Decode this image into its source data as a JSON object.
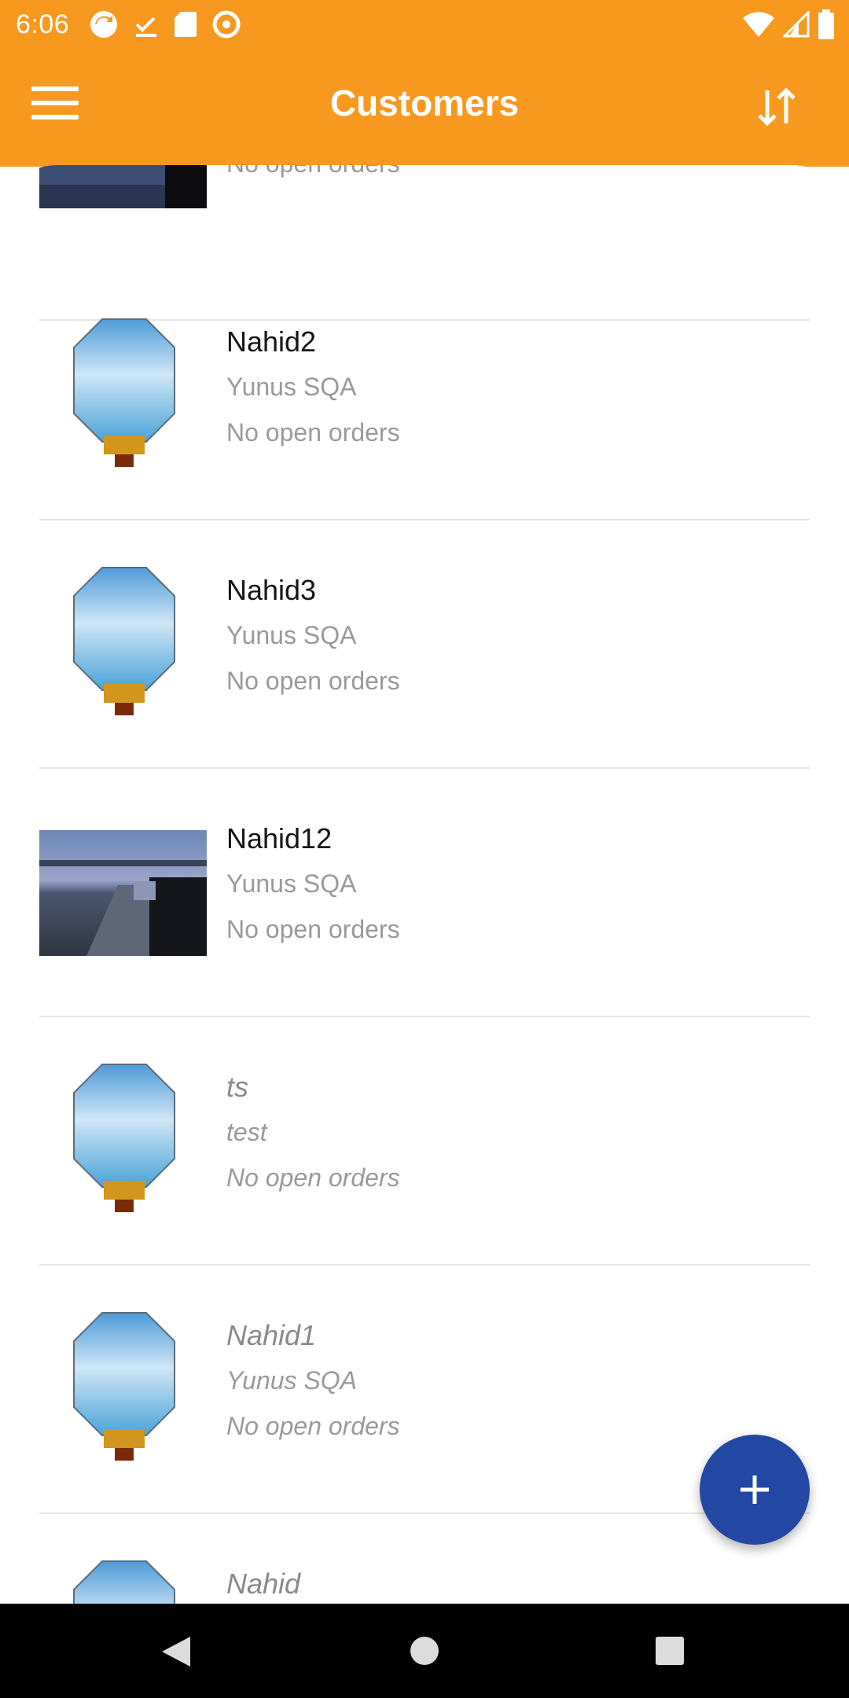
{
  "status_bar": {
    "time": "6:06"
  },
  "app_bar": {
    "title": "Customers"
  },
  "customers": [
    {
      "name": "",
      "company": "",
      "orders": "No open orders"
    },
    {
      "name": "Nahid2",
      "company": "Yunus SQA",
      "orders": "No open orders"
    },
    {
      "name": "Nahid3",
      "company": "Yunus SQA",
      "orders": "No open orders"
    },
    {
      "name": "Nahid12",
      "company": "Yunus SQA",
      "orders": "No open orders"
    },
    {
      "name": "ts",
      "company": "test",
      "orders": "No open orders"
    },
    {
      "name": "Nahid1",
      "company": "Yunus SQA",
      "orders": "No open orders"
    },
    {
      "name": "Nahid",
      "company": "",
      "orders": ""
    }
  ],
  "colors": {
    "app_bar": "#F7991F",
    "fab": "#2348A3",
    "nav_bar": "#000000"
  },
  "icons": {
    "menu": "hamburger-icon",
    "sort": "sort-icon",
    "fab": "plus-icon"
  }
}
